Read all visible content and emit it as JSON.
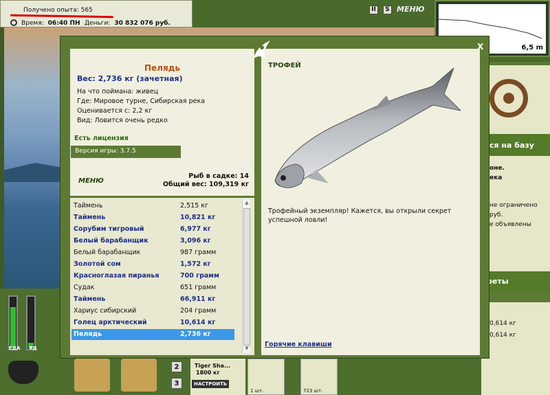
{
  "hud": {
    "xp": "Получено опыта: 565",
    "time_label": "Время:",
    "time_value": "06:40 ПН",
    "money_label": "Деньги:",
    "money_value": "30 832 076 руб."
  },
  "top": {
    "btn1": "II",
    "btn2": "S",
    "menu": "МЕНЮ"
  },
  "depth": {
    "value": "6,5 m"
  },
  "right_panel": {
    "banner1": "ся на базу",
    "lines1": [
      "оне.",
      "ека"
    ],
    "lines2": [
      "не ограничено",
      "руб.",
      "е объявлены"
    ],
    "banner2": "реты",
    "lines3": [
      "0,614 кг",
      "0,614 кг"
    ]
  },
  "bottom": {
    "food_label": "ЕДА",
    "poison_label": "ЯД",
    "slots": [
      "2",
      "3"
    ],
    "tackle_name": "Tiger Sha...",
    "tackle_line": "1800 кг",
    "tackle_button": "НАСТРОИТЬ",
    "item1_count": "1 шт.",
    "item2_count": "723 шт."
  },
  "dialog": {
    "close": "X",
    "fish_name": "Пелядь",
    "weight": "Вес: 2,736 кг (зачетная)",
    "caught_on": "На что поймана: живец",
    "where": "Где: Мировое турне, Сибирская река",
    "valued_from": "Оценивается с: 2,2 кг",
    "kind": "Вид: Ловится очень редко",
    "license": "Есть лицензия",
    "version": "Версия игры: 3.7.5",
    "menu": "МЕНЮ",
    "fish_in_keepnet": "Рыб в садке: 14",
    "total_weight": "Общий вес: 109,319 кг",
    "trophy_title": "ТРОФЕЙ",
    "trophy_text": "Трофейный экземпляр! Кажется, вы открыли секрет успешной ловли!",
    "hotkeys": "Горячие клавиши",
    "catch_list": [
      {
        "name": "Таймень",
        "weight": "2,515 кг",
        "bold": false
      },
      {
        "name": "Таймень",
        "weight": "10,821 кг",
        "bold": true
      },
      {
        "name": "Сорубим тигровый",
        "weight": "6,977 кг",
        "bold": true
      },
      {
        "name": "Белый барабанщик",
        "weight": "3,096 кг",
        "bold": true
      },
      {
        "name": "Белый барабанщик",
        "weight": "987 грамм",
        "bold": false
      },
      {
        "name": "Золотой сом",
        "weight": "1,572 кг",
        "bold": true
      },
      {
        "name": "Красноглазая пиранья",
        "weight": "700 грамм",
        "bold": true
      },
      {
        "name": "Судак",
        "weight": "651 грамм",
        "bold": false
      },
      {
        "name": "Таймень",
        "weight": "66,911 кг",
        "bold": true
      },
      {
        "name": "Хариус сибирский",
        "weight": "204 грамм",
        "bold": false
      },
      {
        "name": "Голец арктический",
        "weight": "10,614 кг",
        "bold": true
      },
      {
        "name": "Пелядь",
        "weight": "2,736 кг",
        "bold": true,
        "selected": true
      }
    ]
  }
}
